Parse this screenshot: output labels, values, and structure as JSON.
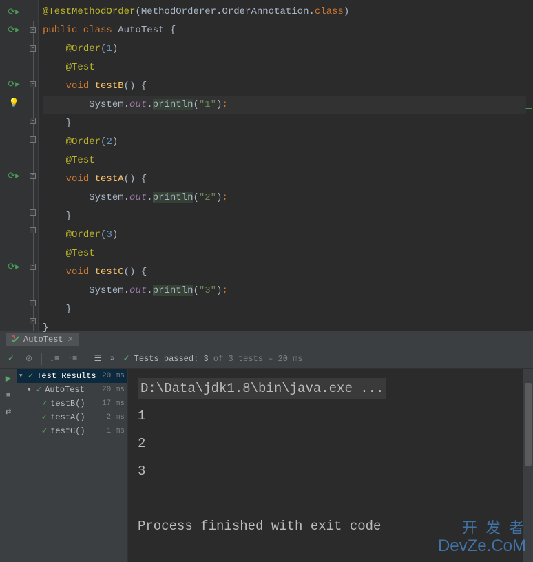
{
  "code": {
    "lines": [
      {
        "indent": 0,
        "tokens": [
          {
            "t": "@TestMethodOrder",
            "c": "kw-olive"
          },
          {
            "t": "(",
            "c": "kw-white"
          },
          {
            "t": "MethodOrderer",
            "c": "kw-white"
          },
          {
            "t": ".",
            "c": "kw-white"
          },
          {
            "t": "OrderAnnotation",
            "c": "kw-white"
          },
          {
            "t": ".",
            "c": "kw-white"
          },
          {
            "t": "class",
            "c": "kw-orange"
          },
          {
            "t": ")",
            "c": "kw-white"
          }
        ]
      },
      {
        "indent": 0,
        "tokens": [
          {
            "t": "public class ",
            "c": "kw-orange"
          },
          {
            "t": "AutoTest ",
            "c": "kw-white"
          },
          {
            "t": "{",
            "c": "kw-white"
          }
        ]
      },
      {
        "indent": 1,
        "tokens": [
          {
            "t": "@Order",
            "c": "kw-olive"
          },
          {
            "t": "(",
            "c": "kw-white"
          },
          {
            "t": "1",
            "c": "kw-blue"
          },
          {
            "t": ")",
            "c": "kw-white"
          }
        ]
      },
      {
        "indent": 1,
        "tokens": [
          {
            "t": "@Test",
            "c": "kw-olive"
          }
        ]
      },
      {
        "indent": 1,
        "tokens": [
          {
            "t": "void ",
            "c": "kw-orange"
          },
          {
            "t": "testB",
            "c": "kw-yellow"
          },
          {
            "t": "() {",
            "c": "kw-white"
          }
        ]
      },
      {
        "indent": 2,
        "hl": true,
        "tokens": [
          {
            "t": "System.",
            "c": "kw-white"
          },
          {
            "t": "out",
            "c": "kw-purple"
          },
          {
            "t": ".",
            "c": "kw-white"
          },
          {
            "t": "println",
            "c": "method-call",
            "bg": true
          },
          {
            "t": "(",
            "c": "kw-white"
          },
          {
            "t": "\"1\"",
            "c": "kw-string"
          },
          {
            "t": ")",
            "c": "kw-white"
          },
          {
            "t": ";",
            "c": "kw-orange"
          }
        ]
      },
      {
        "indent": 1,
        "tokens": [
          {
            "t": "}",
            "c": "kw-white"
          }
        ]
      },
      {
        "indent": 1,
        "tokens": [
          {
            "t": "@Order",
            "c": "kw-olive"
          },
          {
            "t": "(",
            "c": "kw-white"
          },
          {
            "t": "2",
            "c": "kw-blue"
          },
          {
            "t": ")",
            "c": "kw-white"
          }
        ]
      },
      {
        "indent": 1,
        "tokens": [
          {
            "t": "@Test",
            "c": "kw-olive"
          }
        ]
      },
      {
        "indent": 1,
        "tokens": [
          {
            "t": "void ",
            "c": "kw-orange"
          },
          {
            "t": "testA",
            "c": "kw-yellow"
          },
          {
            "t": "() {",
            "c": "kw-white"
          }
        ]
      },
      {
        "indent": 2,
        "tokens": [
          {
            "t": "System.",
            "c": "kw-white"
          },
          {
            "t": "out",
            "c": "kw-purple"
          },
          {
            "t": ".",
            "c": "kw-white"
          },
          {
            "t": "println",
            "c": "method-call",
            "bg": true
          },
          {
            "t": "(",
            "c": "kw-white"
          },
          {
            "t": "\"2\"",
            "c": "kw-string"
          },
          {
            "t": ")",
            "c": "kw-white"
          },
          {
            "t": ";",
            "c": "kw-orange"
          }
        ]
      },
      {
        "indent": 1,
        "tokens": [
          {
            "t": "}",
            "c": "kw-white"
          }
        ]
      },
      {
        "indent": 1,
        "tokens": [
          {
            "t": "@Order",
            "c": "kw-olive"
          },
          {
            "t": "(",
            "c": "kw-white"
          },
          {
            "t": "3",
            "c": "kw-blue"
          },
          {
            "t": ")",
            "c": "kw-white"
          }
        ]
      },
      {
        "indent": 1,
        "tokens": [
          {
            "t": "@Test",
            "c": "kw-olive"
          }
        ]
      },
      {
        "indent": 1,
        "tokens": [
          {
            "t": "void ",
            "c": "kw-orange"
          },
          {
            "t": "testC",
            "c": "kw-yellow"
          },
          {
            "t": "() {",
            "c": "kw-white"
          }
        ]
      },
      {
        "indent": 2,
        "tokens": [
          {
            "t": "System.",
            "c": "kw-white"
          },
          {
            "t": "out",
            "c": "kw-purple"
          },
          {
            "t": ".",
            "c": "kw-white"
          },
          {
            "t": "println",
            "c": "method-call",
            "bg": true
          },
          {
            "t": "(",
            "c": "kw-white"
          },
          {
            "t": "\"3\"",
            "c": "kw-string"
          },
          {
            "t": ")",
            "c": "kw-white"
          },
          {
            "t": ";",
            "c": "kw-orange"
          }
        ]
      },
      {
        "indent": 1,
        "tokens": [
          {
            "t": "}",
            "c": "kw-white"
          }
        ]
      },
      {
        "indent": 0,
        "tokens": [
          {
            "t": "}",
            "c": "kw-white"
          }
        ]
      }
    ],
    "gutter_icons": {
      "0": "run",
      "1": "run",
      "4": "run",
      "5": "bulb",
      "9": "run",
      "14": "run"
    }
  },
  "tab": {
    "label": "AutoTest"
  },
  "toolbar": {
    "tests_passed_prefix": "Tests passed: ",
    "tests_passed_count": "3",
    "tests_total": " of 3 tests",
    "tests_time": " – 20 ms"
  },
  "tree": {
    "root": {
      "label": "Test Results",
      "time": "20 ms"
    },
    "suite": {
      "label": "AutoTest",
      "time": "20 ms"
    },
    "tests": [
      {
        "label": "testB()",
        "time": "17 ms"
      },
      {
        "label": "testA()",
        "time": "2 ms"
      },
      {
        "label": "testC()",
        "time": "1 ms"
      }
    ]
  },
  "console": {
    "cmd": "D:\\Data\\jdk1.8\\bin\\java.exe ...",
    "out": [
      "1",
      "2",
      "3",
      "",
      "Process finished with exit code"
    ]
  },
  "watermark": {
    "row1": "开 发 者",
    "row2": "DevZe.CoM"
  }
}
